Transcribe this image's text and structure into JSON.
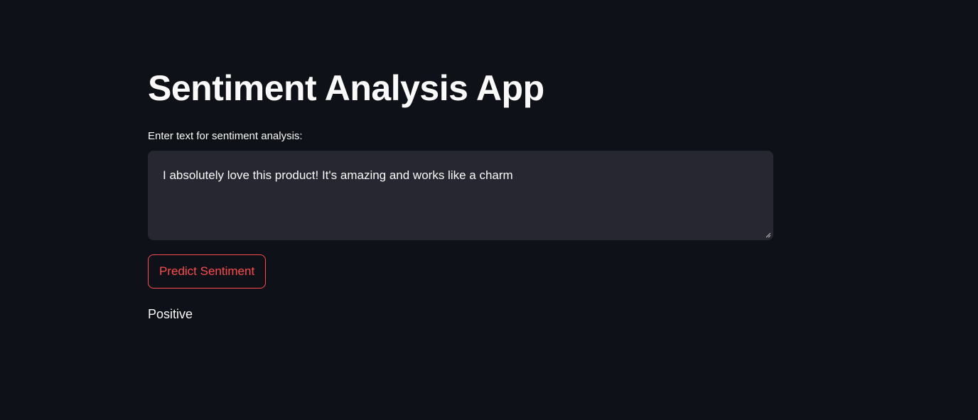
{
  "app": {
    "title": "Sentiment Analysis App"
  },
  "input": {
    "label": "Enter text for sentiment analysis:",
    "value": "I absolutely love this product! It's amazing and works like a charm"
  },
  "actions": {
    "predict_label": "Predict Sentiment"
  },
  "result": {
    "sentiment": "Positive"
  },
  "colors": {
    "background": "#0e1117",
    "input_background": "#262730",
    "accent": "#ff4b4b",
    "text": "#fafafa"
  }
}
